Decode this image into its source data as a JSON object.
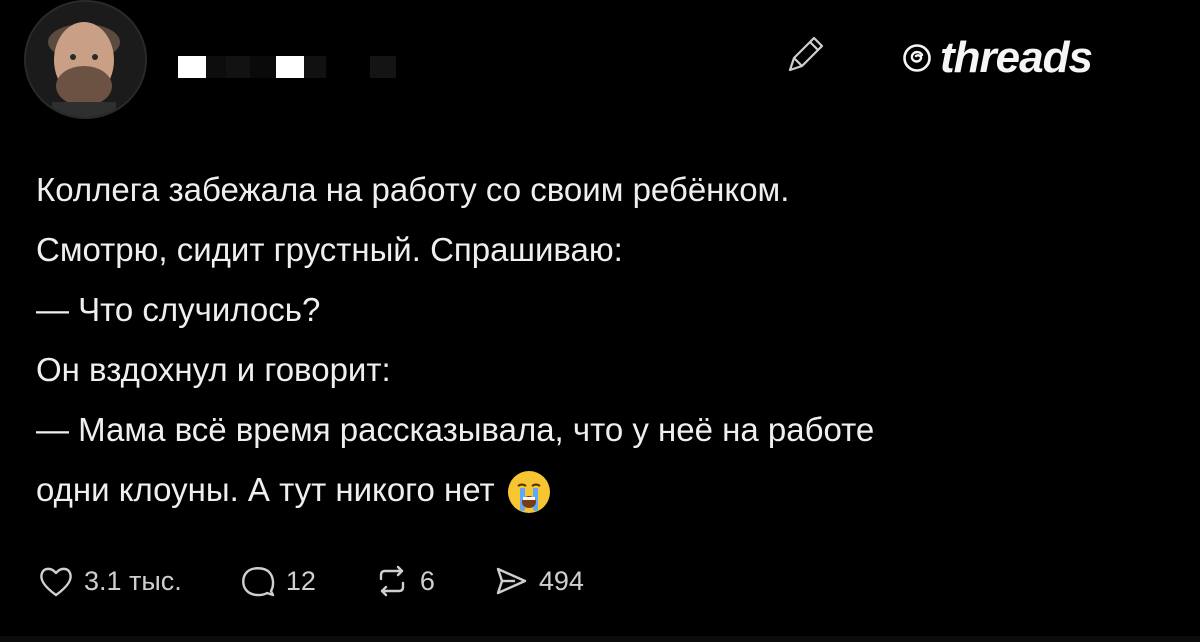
{
  "header": {
    "brand_text": "threads"
  },
  "post": {
    "lines": [
      "Коллега забежала на работу со своим ребёнком.",
      "Смотрю, сидит грустный. Спрашиваю:",
      "— Что случилось?",
      "Он вздохнул и говорит:",
      "— Мама всё время рассказывала, что у неё на работе",
      "одни клоуны. А тут никого нет"
    ],
    "emoji": "crying-face"
  },
  "actions": {
    "likes": "3.1 тыс.",
    "comments": "12",
    "reposts": "6",
    "shares": "494"
  },
  "colors": {
    "background": "#000000",
    "text": "#efefef",
    "emoji_yellow": "#f7c531",
    "emoji_tears": "#5aa9ff"
  }
}
